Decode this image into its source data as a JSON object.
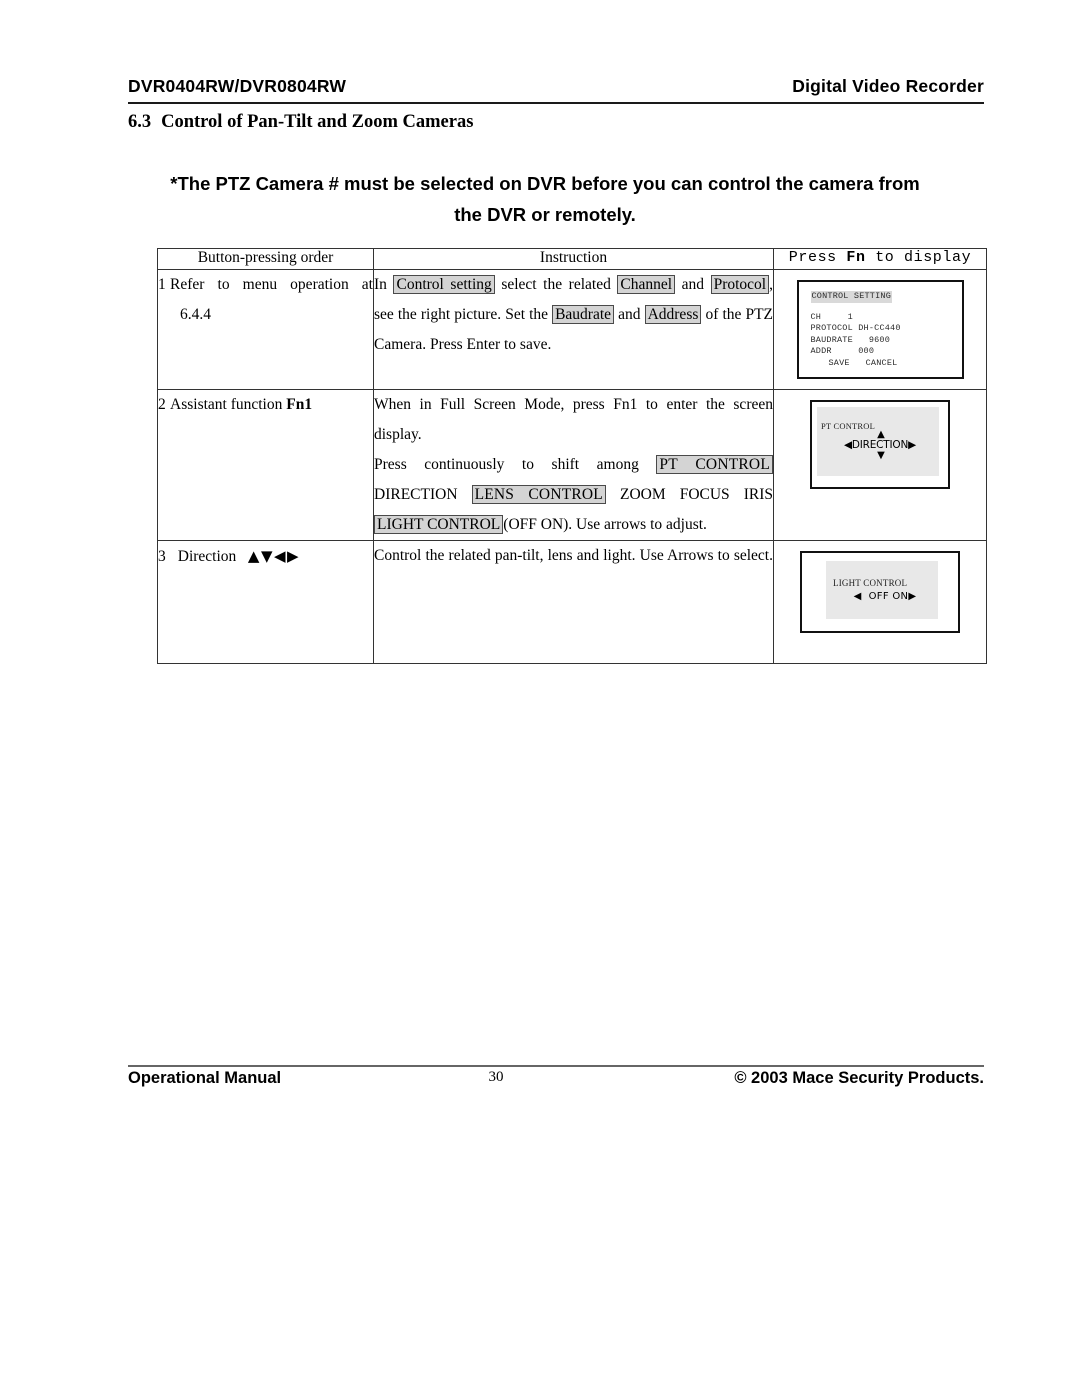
{
  "header": {
    "left": "DVR0404RW/DVR0804RW",
    "right": "Digital Video Recorder"
  },
  "section": {
    "number": "6.3",
    "title": "Control of Pan-Tilt and Zoom Cameras"
  },
  "note": {
    "line1": "*The PTZ Camera # must be selected on DVR before you can control the camera from",
    "line2": "the DVR or remotely."
  },
  "table": {
    "headers": {
      "order": "Button-pressing order",
      "instruction": "Instruction",
      "display_pre": "Press ",
      "display_key": "Fn",
      "display_post": " to display"
    },
    "rows": [
      {
        "num": "1",
        "order_line1": "Refer to menu operation at",
        "order_line2": "6.4.4",
        "instruction": {
          "t1": "In ",
          "h1": "Control setting",
          "t2": " select the related ",
          "h2": "Channel",
          "t3": " and ",
          "h3": "Protocol",
          "t4": ", see the right picture. Set the ",
          "h4": "Baudrate",
          "t5": " and ",
          "h5": "Address",
          "t6": " of the PTZ Camera. Press Enter to save."
        },
        "panel": {
          "kind": "control-setting",
          "title": "CONTROL SETTING",
          "fields": [
            {
              "label": "CH",
              "value": "1"
            },
            {
              "label": "PROTOCOL",
              "value": "DH-CC440"
            },
            {
              "label": "BAUDRATE",
              "value": "9600"
            },
            {
              "label": "ADDR",
              "value": "000"
            }
          ],
          "save": "SAVE",
          "cancel": "CANCEL"
        }
      },
      {
        "num": "2",
        "order_text": "Assistant function ",
        "order_bold": "Fn1",
        "instruction": {
          "p1": "When in Full Screen Mode, press Fn1 to enter the screen display.",
          "p2a": "Press continuously to shift among ",
          "p2h1": "PT  CONTROL",
          "p2b": " DIRECTION ",
          "p2h2": "LENS  CONTROL",
          "p2c": " ZOOM  FOCUS  IRIS ",
          "p2h3": "LIGHT CONTROL",
          "p2d": "(OFF ON). Use arrows to adjust."
        },
        "panel": {
          "kind": "pt-control",
          "title": "PT CONTROL",
          "up": "▲",
          "down": "▼",
          "left": "◀",
          "right": "▶",
          "center": "DIRECTION"
        }
      },
      {
        "num": "3",
        "order_text": "Direction",
        "order_arrows": "▲▼◀▶",
        "instruction": {
          "p1": "Control the related pan-tilt, lens and light. Use Arrows to select."
        },
        "panel": {
          "kind": "light-control",
          "title": "LIGHT CONTROL",
          "left": "◀",
          "options": "OFF ON",
          "right": "▶"
        }
      }
    ]
  },
  "footer": {
    "left": "Operational Manual",
    "page": "30",
    "right": "© 2003 Mace Security Products."
  }
}
